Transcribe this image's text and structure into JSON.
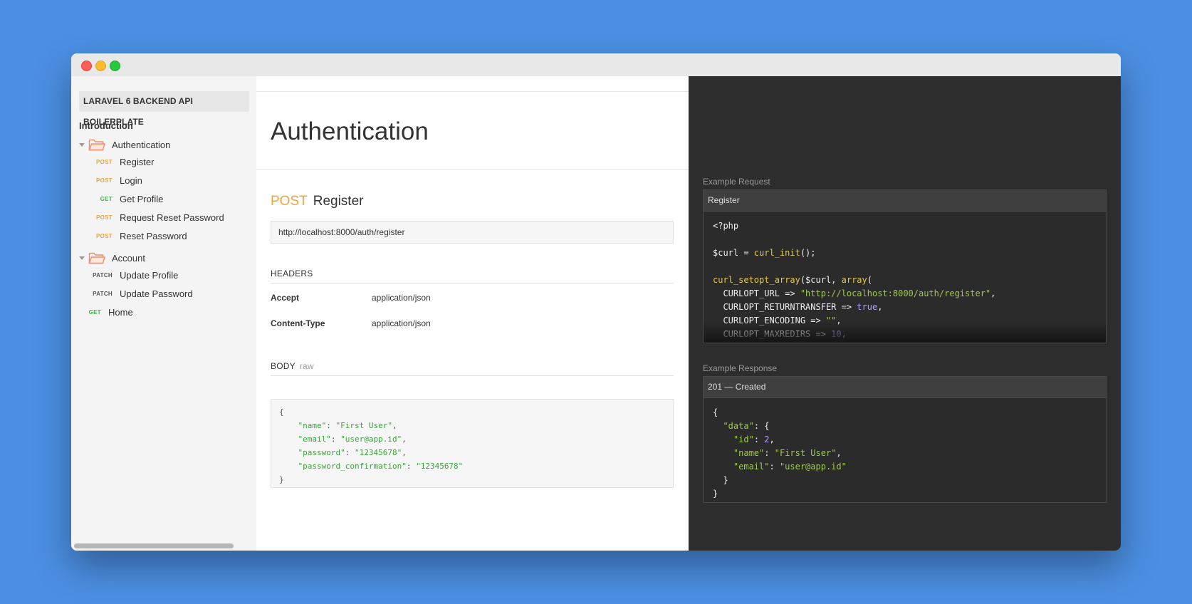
{
  "sidebar": {
    "brand": "LARAVEL 6 BACKEND API BOILERPLATE",
    "intro": "Introduction",
    "folders": [
      {
        "label": "Authentication",
        "items": [
          {
            "method": "POST",
            "label": "Register"
          },
          {
            "method": "POST",
            "label": "Login"
          },
          {
            "method": "GET",
            "label": "Get Profile"
          },
          {
            "method": "POST",
            "label": "Request Reset Password"
          },
          {
            "method": "POST",
            "label": "Reset Password"
          }
        ]
      },
      {
        "label": "Account",
        "items": [
          {
            "method": "PATCH",
            "label": "Update Profile"
          },
          {
            "method": "PATCH",
            "label": "Update Password"
          }
        ]
      }
    ],
    "root_items": [
      {
        "method": "GET",
        "label": "Home"
      }
    ]
  },
  "main": {
    "title": "Authentication",
    "request": {
      "method": "POST",
      "name": "Register",
      "url": "http://localhost:8000/auth/register",
      "headers_title": "HEADERS",
      "headers": [
        {
          "key": "Accept",
          "value": "application/json"
        },
        {
          "key": "Content-Type",
          "value": "application/json"
        }
      ],
      "body_title": "BODY",
      "body_mode": "raw",
      "body_lines": [
        {
          "indent": "",
          "key": "",
          "value": "{",
          "comma": ""
        },
        {
          "indent": "    ",
          "key": "\"name\"",
          "value": "\"First User\"",
          "comma": ","
        },
        {
          "indent": "    ",
          "key": "\"email\"",
          "value": "\"user@app.id\"",
          "comma": ","
        },
        {
          "indent": "    ",
          "key": "\"password\"",
          "value": "\"12345678\"",
          "comma": ","
        },
        {
          "indent": "    ",
          "key": "\"password_confirmation\"",
          "value": "\"12345678\"",
          "comma": ""
        },
        {
          "indent": "",
          "key": "",
          "value": "}",
          "comma": ""
        }
      ]
    }
  },
  "right": {
    "example_request_label": "Example Request",
    "example_request_name": "Register",
    "example_response_label": "Example Response",
    "example_response_status": "201 — Created"
  },
  "colors": {
    "post": "#f0a43c",
    "get": "#42b547",
    "patch": "#555555",
    "folder": "#f08c6c",
    "code_bg": "#2d2d2d"
  },
  "icons": {
    "folder": "folder-open-icon",
    "caret": "caret-down-icon"
  }
}
